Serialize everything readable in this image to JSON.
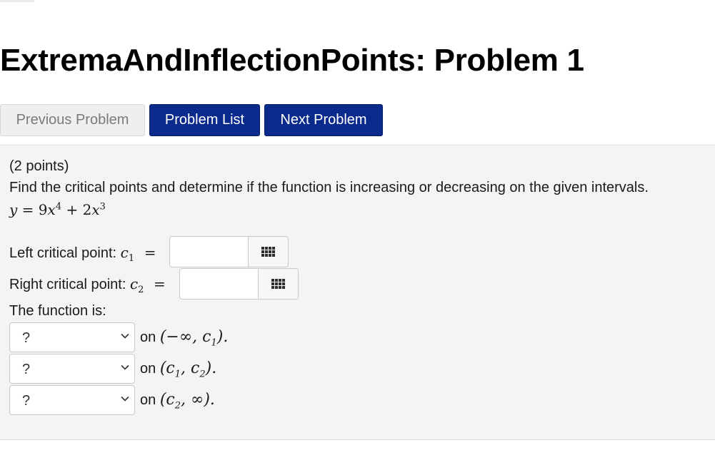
{
  "header": {
    "title": "ExtremaAndInflectionPoints: Problem 1"
  },
  "nav": {
    "previous_label": "Previous Problem",
    "list_label": "Problem List",
    "next_label": "Next Problem"
  },
  "problem": {
    "points": "(2 points)",
    "instructions": "Find the critical points and determine if the function is increasing or decreasing on the given intervals.",
    "function_lhs": "y",
    "function_rhs_coef1": "9",
    "function_rhs_var1": "x",
    "function_rhs_exp1": "4",
    "function_rhs_plus": "+",
    "function_rhs_coef2": "2",
    "function_rhs_var2": "x",
    "function_rhs_exp2": "3",
    "equals": "=",
    "left_critical_label": "Left critical point:",
    "left_critical_var": "c",
    "left_critical_sub": "1",
    "left_critical_value": "",
    "right_critical_label": "Right critical point:",
    "right_critical_var": "c",
    "right_critical_sub": "2",
    "right_critical_value": "",
    "function_is_label": "The function is:",
    "intervals": [
      {
        "select_value": "?",
        "on_label": "on"
      },
      {
        "select_value": "?",
        "on_label": "on"
      },
      {
        "select_value": "?",
        "on_label": "on"
      }
    ]
  },
  "icons": {
    "palette": "grid-icon",
    "dropdown": "chevron-down-icon"
  },
  "colors": {
    "primary_button": "#0a2a8c",
    "disabled_button": "#efefef",
    "panel_background": "#f4f4f4"
  }
}
